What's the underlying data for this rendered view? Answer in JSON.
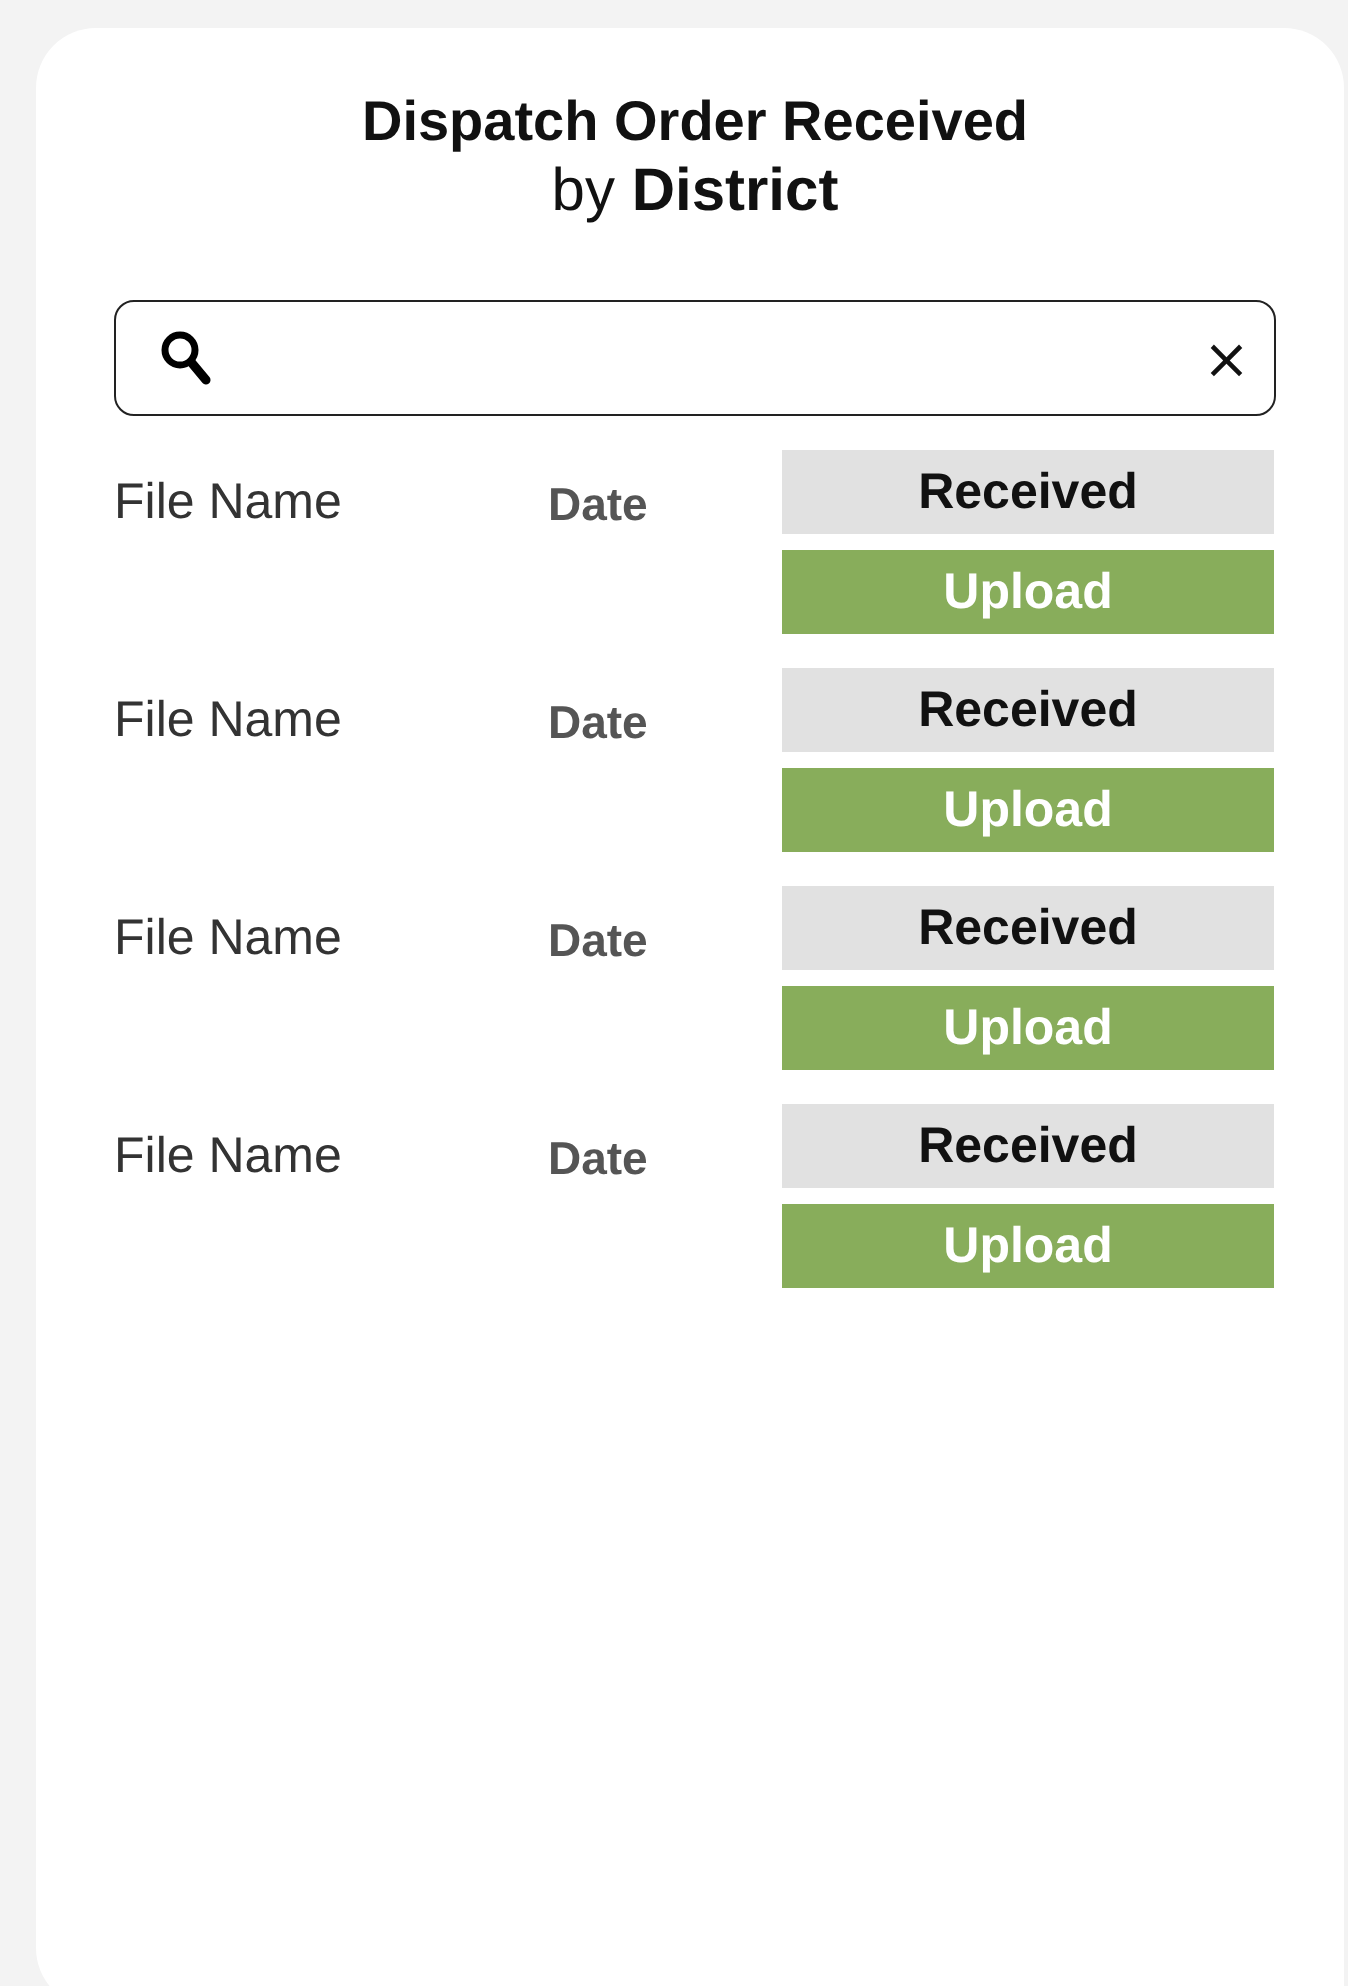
{
  "title": "Dispatch Order Received",
  "subtitle": "by **District**",
  "search": {
    "clear": "×"
  },
  "rows": [
    {
      "file_name": "File Name",
      "date": "Date",
      "status": "Received",
      "action": "Upload"
    },
    {
      "file_name": "File Name",
      "date": "Date",
      "status": "Received",
      "action": "Upload"
    },
    {
      "file_name": "File Name",
      "date": "Date",
      "status": "Received",
      "action": "Upload"
    },
    {
      "file_name": "File Name",
      "date": "Date",
      "status": "Received",
      "action": "Upload"
    }
  ]
}
